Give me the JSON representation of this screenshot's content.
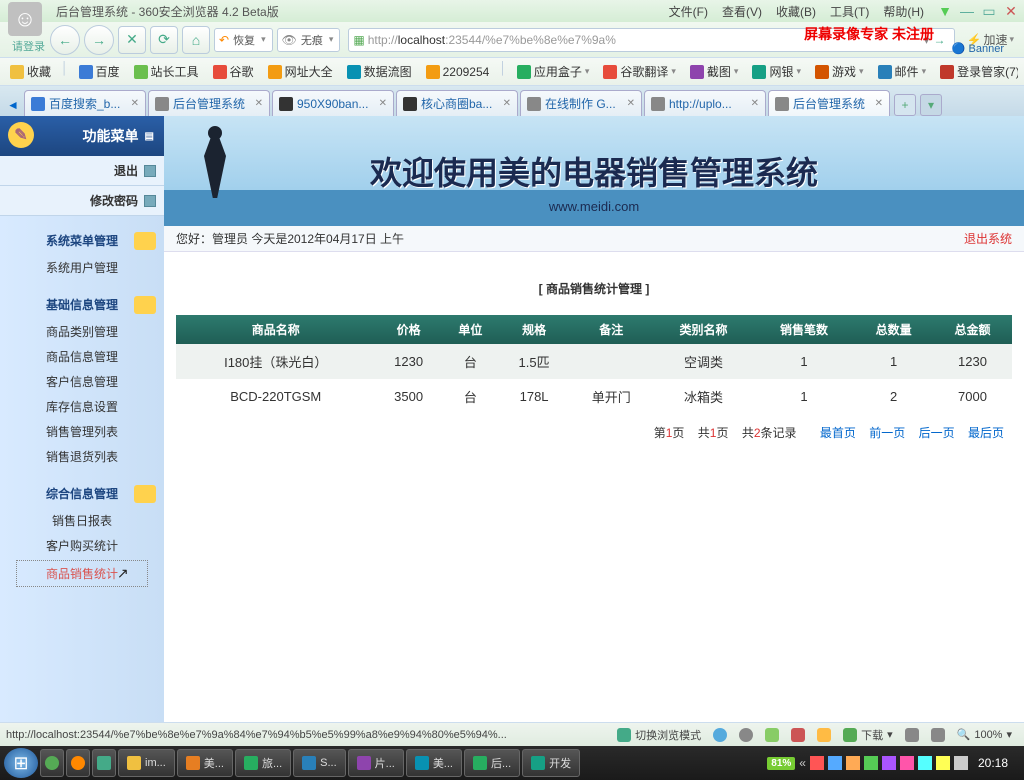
{
  "window": {
    "title": "后台管理系统 - 360安全浏览器 4.2 Beta版",
    "login_label": "请登录"
  },
  "menubar": {
    "file": "文件(F)",
    "view": "查看(V)",
    "fav": "收藏(B)",
    "tool": "工具(T)",
    "help": "帮助(H)"
  },
  "toolbar": {
    "restore": "恢复",
    "incognito": "无痕",
    "accel": "加速",
    "url_proto": "http://",
    "url_host": "localhost",
    "url_port_path": ":23544/%e7%be%8e%e7%9a%",
    "overlay_brand": "屏幕录像专家  未注册",
    "overlay_banner": "Banner"
  },
  "bookmarks": [
    {
      "label": "收藏",
      "color": "#f0c040"
    },
    {
      "label": "百度",
      "color": "#3b7bd6"
    },
    {
      "label": "站长工具",
      "color": "#6bbf4e"
    },
    {
      "label": "谷歌",
      "color": "#e74c3c"
    },
    {
      "label": "网址大全",
      "color": "#f39c12"
    },
    {
      "label": "数据流图",
      "color": "#0891b2"
    },
    {
      "label": "2209254",
      "color": "#f39c12"
    },
    {
      "label": "应用盒子",
      "color": "#27ae60"
    },
    {
      "label": "谷歌翻译",
      "color": "#e74c3c"
    },
    {
      "label": "截图",
      "color": "#8e44ad"
    },
    {
      "label": "网银",
      "color": "#16a085"
    },
    {
      "label": "游戏",
      "color": "#d35400"
    },
    {
      "label": "邮件",
      "color": "#2980b9"
    },
    {
      "label": "登录管家(7)",
      "color": "#c0392b"
    }
  ],
  "tabs": [
    {
      "label": "百度搜索_b...",
      "fav": "#3b7bd6",
      "active": false
    },
    {
      "label": "后台管理系统",
      "fav": "#888",
      "active": false
    },
    {
      "label": "950X90ban...",
      "fav": "#333",
      "active": false
    },
    {
      "label": "核心商圈ba...",
      "fav": "#333",
      "active": false
    },
    {
      "label": "在线制作 G...",
      "fav": "#888",
      "active": false
    },
    {
      "label": "http://uplo...",
      "fav": "#888",
      "active": false
    },
    {
      "label": "后台管理系统",
      "fav": "#888",
      "active": true
    }
  ],
  "sidebar": {
    "header": "功能菜单",
    "exit": "退出",
    "changepwd": "修改密码",
    "groups": [
      {
        "title": "系统菜单管理",
        "items": [
          "系统用户管理"
        ]
      },
      {
        "title": "基础信息管理",
        "items": [
          "商品类别管理",
          "商品信息管理",
          "客户信息管理",
          "库存信息设置",
          "销售管理列表",
          "销售退货列表"
        ]
      },
      {
        "title": "综合信息管理",
        "items": [
          "销售日报表",
          "客户购买统计",
          "商品销售统计"
        ]
      }
    ]
  },
  "banner": {
    "title": "欢迎使用美的电器销售管理系统",
    "sub": "www.meidi.com"
  },
  "infobar": {
    "greeting": "您好：管理员    今天是2012年04月17日        上午",
    "exit": "退出系统"
  },
  "page": {
    "title": "[ 商品销售统计管理 ]",
    "headers": [
      "商品名称",
      "价格",
      "单位",
      "规格",
      "备注",
      "类别名称",
      "销售笔数",
      "总数量",
      "总金额"
    ],
    "rows": [
      [
        "I180挂（珠光白）",
        "1230",
        "台",
        "1.5匹",
        "",
        "空调类",
        "1",
        "1",
        "1230"
      ],
      [
        "BCD-220TGSM",
        "3500",
        "台",
        "178L",
        "单开门",
        "冰箱类",
        "1",
        "2",
        "7000"
      ]
    ],
    "pager": {
      "cur_pre": "第",
      "cur": "1",
      "cur_suf": "页",
      "tot_pre": "共",
      "tot": "1",
      "tot_suf": "页",
      "rec_pre": "共",
      "rec": "2",
      "rec_suf": "条记录",
      "first": "最首页",
      "prev": "前一页",
      "next": "后一页",
      "last": "最后页"
    }
  },
  "statusbar": {
    "url": "http://localhost:23544/%e7%be%8e%e7%9a%84%e7%94%b5%e5%99%a8%e9%94%80%e5%94%...",
    "switch": "切换浏览模式",
    "download": "下载",
    "zoom": "100%"
  },
  "taskbar": {
    "buttons": [
      {
        "label": "im...",
        "color": "#f0c040"
      },
      {
        "label": "美...",
        "color": "#e67e22"
      },
      {
        "label": "旅...",
        "color": "#27ae60"
      },
      {
        "label": "S...",
        "color": "#2980b9"
      },
      {
        "label": "片...",
        "color": "#8e44ad"
      },
      {
        "label": "美...",
        "color": "#0891b2"
      },
      {
        "label": "后...",
        "color": "#27ae60"
      },
      {
        "label": "开发",
        "color": "#16a085"
      }
    ],
    "battery": "81%",
    "clock": "20:18"
  }
}
